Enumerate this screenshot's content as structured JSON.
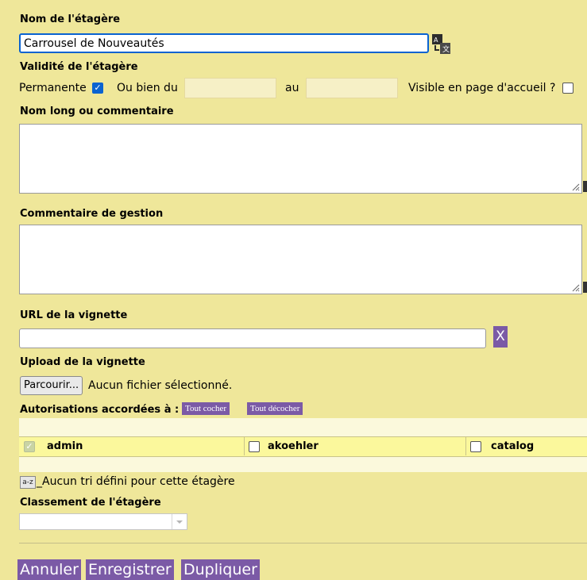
{
  "shelf_name": {
    "label": "Nom de l'étagère",
    "value": "Carrousel de Nouveautés"
  },
  "icons": {
    "translate": "translate-icon",
    "sort": "sort-az-icon",
    "resize": "resize-grip-icon",
    "dropdown": "chevron-down-icon"
  },
  "validity": {
    "label": "Validité de l'étagère",
    "permanent_label": "Permanente",
    "permanent_checked": true,
    "or_from_label": "Ou bien du",
    "to_label": "au",
    "from_value": "",
    "to_value": "",
    "visible_home_label": "Visible en page d'accueil ?",
    "visible_home_checked": false
  },
  "long_name": {
    "label": "Nom long ou commentaire",
    "value": ""
  },
  "management_comment": {
    "label": "Commentaire de gestion",
    "value": ""
  },
  "thumbnail_url": {
    "label": "URL de la vignette",
    "value": "",
    "clear_label": "X"
  },
  "thumbnail_upload": {
    "label": "Upload de la vignette",
    "browse_label": "Parcourir...",
    "no_file_text": "Aucun fichier sélectionné."
  },
  "permissions": {
    "label": "Autorisations accordées à :",
    "check_all_label": "Tout cocher",
    "uncheck_all_label": "Tout décocher",
    "users": [
      {
        "name": "admin",
        "checked": true,
        "disabled": true
      },
      {
        "name": "akoehler",
        "checked": false,
        "disabled": false
      },
      {
        "name": "catalog",
        "checked": false,
        "disabled": false
      }
    ]
  },
  "sort": {
    "icon_text": "a-z",
    "text": "_Aucun tri défini pour cette étagère"
  },
  "classification": {
    "label": "Classement de l'étagère",
    "value": ""
  },
  "actions": {
    "cancel": "Annuler",
    "save": "Enregistrer",
    "duplicate": "Dupliquer"
  },
  "colors": {
    "background": "#efe79a",
    "accent": "#7b5aa6",
    "focus": "#0a63d1"
  }
}
